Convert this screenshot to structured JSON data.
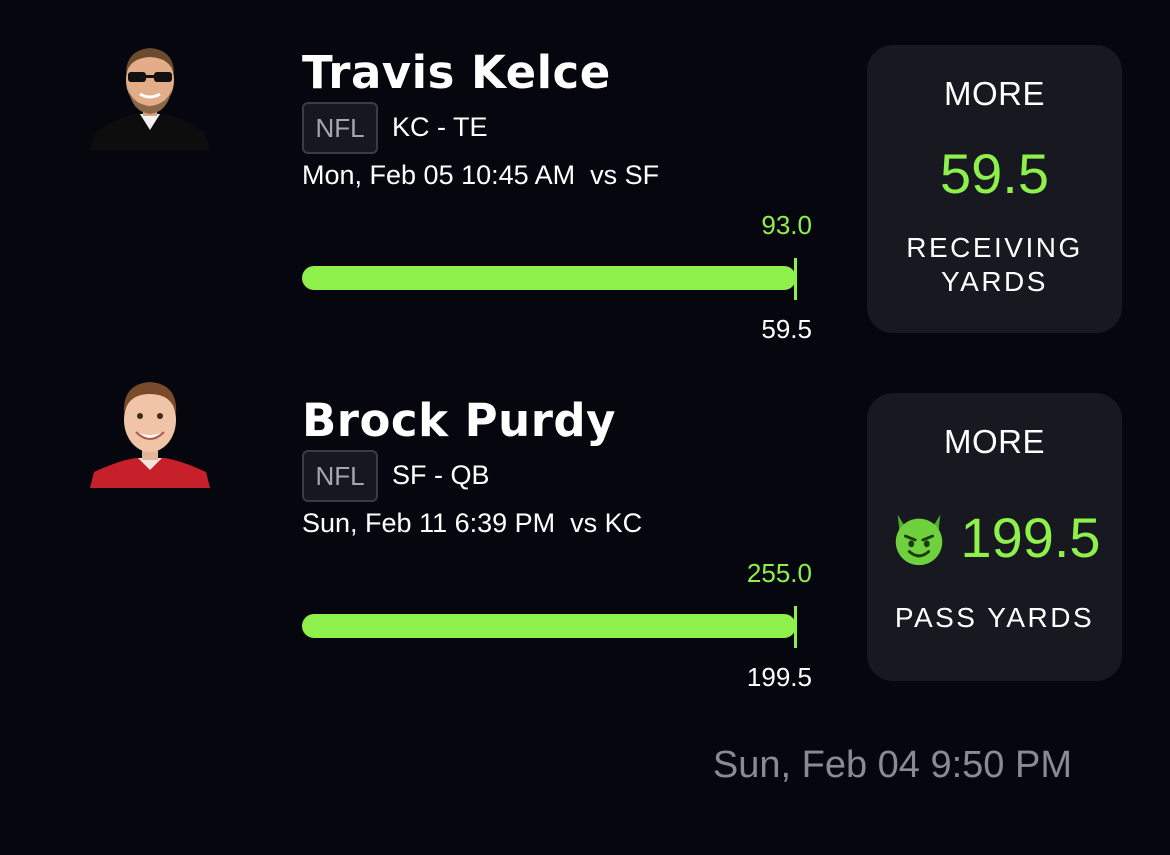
{
  "picks": [
    {
      "player": "Travis Kelce",
      "avatar_icon": "player-headshot-icon",
      "league": "NFL",
      "team_position": "KC - TE",
      "game_info": "Mon, Feb 05 10:45 AM  vs SF",
      "actual": "93.0",
      "line": "59.5",
      "progress_fraction": 1.0,
      "direction": "MORE",
      "projection": "59.5",
      "stat_type": "RECEIVING YARDS",
      "has_demon": false
    },
    {
      "player": "Brock Purdy",
      "avatar_icon": "player-headshot-icon",
      "league": "NFL",
      "team_position": "SF - QB",
      "game_info": "Sun, Feb 11 6:39 PM  vs KC",
      "actual": "255.0",
      "line": "199.5",
      "progress_fraction": 1.0,
      "direction": "MORE",
      "projection": "199.5",
      "stat_type": "PASS YARDS",
      "has_demon": true,
      "demon_icon": "smiling-devil-icon"
    }
  ],
  "timestamp": "Sun, Feb 04 9:50 PM",
  "colors": {
    "accent": "#8ef04a",
    "background": "#06060f",
    "card": "#171820",
    "muted": "#8a8a92"
  }
}
